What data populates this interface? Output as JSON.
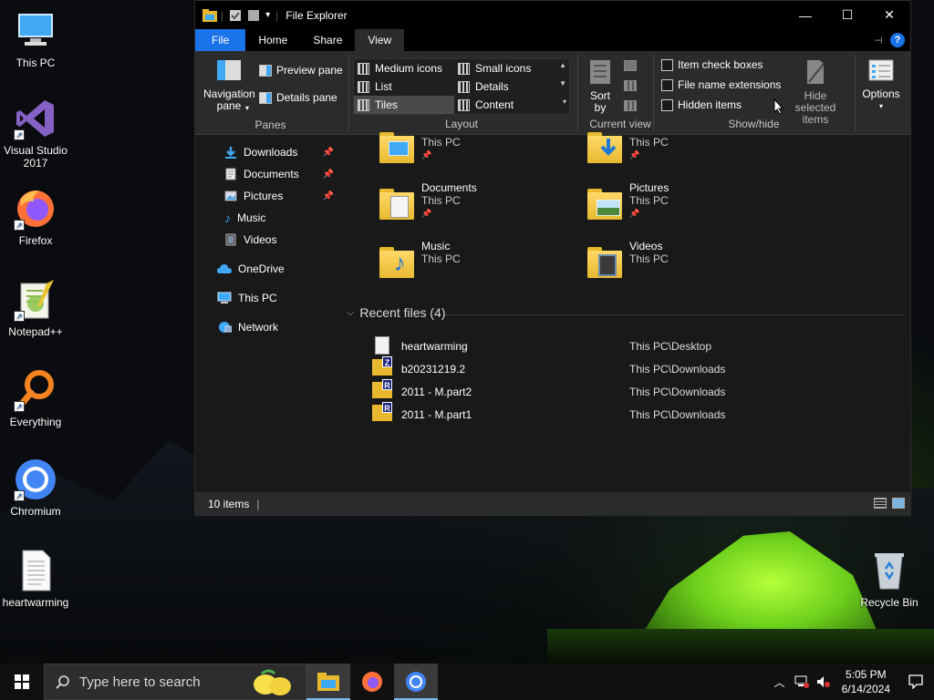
{
  "desktop": {
    "icons": [
      {
        "label": "This PC",
        "icon": "this-pc-icon"
      },
      {
        "label": "Visual Studio 2017",
        "icon": "visual-studio-icon"
      },
      {
        "label": "Firefox",
        "icon": "firefox-icon"
      },
      {
        "label": "Notepad++",
        "icon": "notepad-plus-plus-icon"
      },
      {
        "label": "Everything",
        "icon": "everything-icon"
      },
      {
        "label": "Chromium",
        "icon": "chromium-icon"
      },
      {
        "label": "heartwarming",
        "icon": "text-file-icon"
      },
      {
        "label": "Recycle Bin",
        "icon": "recycle-bin-icon"
      }
    ]
  },
  "explorer": {
    "title": "File Explorer",
    "tabs": [
      "File",
      "Home",
      "Share",
      "View"
    ],
    "active_tab": "View",
    "ribbon": {
      "panes": {
        "navigation_pane": "Navigation pane",
        "preview_pane": "Preview pane",
        "details_pane": "Details pane",
        "group_label": "Panes"
      },
      "layout": {
        "options": [
          "Medium icons",
          "Small icons",
          "List",
          "Details",
          "Tiles",
          "Content"
        ],
        "selected": "Tiles",
        "group_label": "Layout"
      },
      "current_view": {
        "sort_by": "Sort by",
        "group_label": "Current view"
      },
      "show_hide": {
        "item_check_boxes": "Item check boxes",
        "file_name_extensions": "File name extensions",
        "hidden_items": "Hidden items",
        "hide_selected_items": "Hide selected items",
        "group_label": "Show/hide"
      },
      "options": "Options"
    },
    "nav": [
      {
        "label": "Downloads",
        "pinned": true,
        "icon": "downloads-icon"
      },
      {
        "label": "Documents",
        "pinned": true,
        "icon": "documents-icon"
      },
      {
        "label": "Pictures",
        "pinned": true,
        "icon": "pictures-icon"
      },
      {
        "label": "Music",
        "pinned": false,
        "icon": "music-icon"
      },
      {
        "label": "Videos",
        "pinned": false,
        "icon": "videos-icon"
      },
      {
        "label": "OneDrive",
        "pinned": false,
        "icon": "onedrive-icon"
      },
      {
        "label": "This PC",
        "pinned": false,
        "icon": "this-pc-icon"
      },
      {
        "label": "Network",
        "pinned": false,
        "icon": "network-icon"
      }
    ],
    "quick_access": [
      {
        "name": "",
        "location": "This PC",
        "pinned": true,
        "icon": "desktop-folder-icon"
      },
      {
        "name": "",
        "location": "This PC",
        "pinned": true,
        "icon": "downloads-folder-icon"
      },
      {
        "name": "Documents",
        "location": "This PC",
        "pinned": true,
        "icon": "documents-folder-icon"
      },
      {
        "name": "Pictures",
        "location": "This PC",
        "pinned": true,
        "icon": "pictures-folder-icon"
      },
      {
        "name": "Music",
        "location": "This PC",
        "pinned": false,
        "icon": "music-folder-icon"
      },
      {
        "name": "Videos",
        "location": "This PC",
        "pinned": false,
        "icon": "videos-folder-icon"
      }
    ],
    "recent_header": "Recent files (4)",
    "recent_files": [
      {
        "name": "heartwarming",
        "location": "This PC\\Desktop",
        "badge": ""
      },
      {
        "name": "b20231219.2",
        "location": "This PC\\Downloads",
        "badge": "Z"
      },
      {
        "name": "2011 - M.part2",
        "location": "This PC\\Downloads",
        "badge": "R"
      },
      {
        "name": "2011 - M.part1",
        "location": "This PC\\Downloads",
        "badge": "R"
      }
    ],
    "status": "10 items"
  },
  "taskbar": {
    "search_placeholder": "Type here to search",
    "time": "5:05 PM",
    "date": "6/14/2024"
  },
  "colors": {
    "accent": "#1a73e8",
    "folder": "#e8b92f",
    "window_bg": "#191919",
    "ribbon_bg": "#2b2b2b"
  }
}
